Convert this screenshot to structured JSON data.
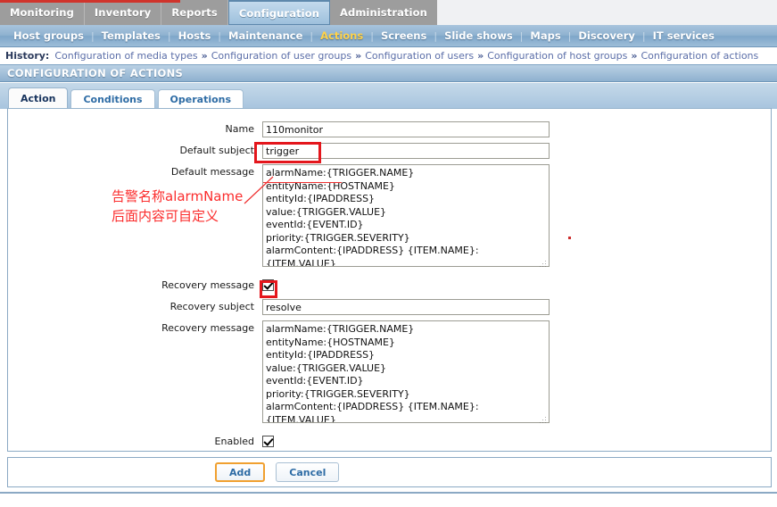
{
  "main_menu": {
    "items": [
      {
        "label": "Monitoring",
        "selected": false
      },
      {
        "label": "Inventory",
        "selected": false
      },
      {
        "label": "Reports",
        "selected": false
      },
      {
        "label": "Configuration",
        "selected": true
      },
      {
        "label": "Administration",
        "selected": false
      }
    ]
  },
  "sub_menu": {
    "items": [
      {
        "label": "Host groups",
        "current": false
      },
      {
        "label": "Templates",
        "current": false
      },
      {
        "label": "Hosts",
        "current": false
      },
      {
        "label": "Maintenance",
        "current": false
      },
      {
        "label": "Actions",
        "current": true
      },
      {
        "label": "Screens",
        "current": false
      },
      {
        "label": "Slide shows",
        "current": false
      },
      {
        "label": "Maps",
        "current": false
      },
      {
        "label": "Discovery",
        "current": false
      },
      {
        "label": "IT services",
        "current": false
      }
    ],
    "separator": "|"
  },
  "history": {
    "label": "History:",
    "separator": "»",
    "links": [
      "Configuration of media types",
      "Configuration of user groups",
      "Configuration of users",
      "Configuration of host groups",
      "Configuration of actions"
    ]
  },
  "page_title": "CONFIGURATION OF ACTIONS",
  "tabs": [
    {
      "label": "Action",
      "active": true
    },
    {
      "label": "Conditions",
      "active": false
    },
    {
      "label": "Operations",
      "active": false
    }
  ],
  "form": {
    "name": {
      "label": "Name",
      "value": "110monitor",
      "placeholder": ""
    },
    "default_subject": {
      "label": "Default subject",
      "value": "trigger",
      "placeholder": ""
    },
    "default_message": {
      "label": "Default message",
      "value": "alarmName:{TRIGGER.NAME}\nentityName:{HOSTNAME}\nentityId:{IPADDRESS}\nvalue:{TRIGGER.VALUE}\neventId:{EVENT.ID}\npriority:{TRIGGER.SEVERITY}\nalarmContent:{IPADDRESS} {ITEM.NAME}:\n{ITEM.VALUE}"
    },
    "recovery_message_toggle": {
      "label": "Recovery message",
      "checked": true
    },
    "recovery_subject": {
      "label": "Recovery subject",
      "value": "resolve",
      "placeholder": ""
    },
    "recovery_message": {
      "label": "Recovery message",
      "value": "alarmName:{TRIGGER.NAME}\nentityName:{HOSTNAME}\nentityId:{IPADDRESS}\nvalue:{TRIGGER.VALUE}\neventId:{EVENT.ID}\npriority:{TRIGGER.SEVERITY}\nalarmContent:{IPADDRESS} {ITEM.NAME}:\n{ITEM.VALUE}"
    },
    "enabled": {
      "label": "Enabled",
      "checked": true
    }
  },
  "buttons": {
    "add": "Add",
    "cancel": "Cancel"
  },
  "annotations": {
    "chinese_line1": "告警名称alarmName",
    "chinese_line2": "后面内容可自定义"
  },
  "colors": {
    "accent_red": "#d0342c",
    "annotation_red": "#e4161c",
    "selected_menu_blue": "#9ec0dc",
    "subnav_blue": "#8fb2d0",
    "current_subnav_yellow": "#ffd24a",
    "button_focus_orange": "#f0a030",
    "link_blue": "#2e6ca5"
  }
}
